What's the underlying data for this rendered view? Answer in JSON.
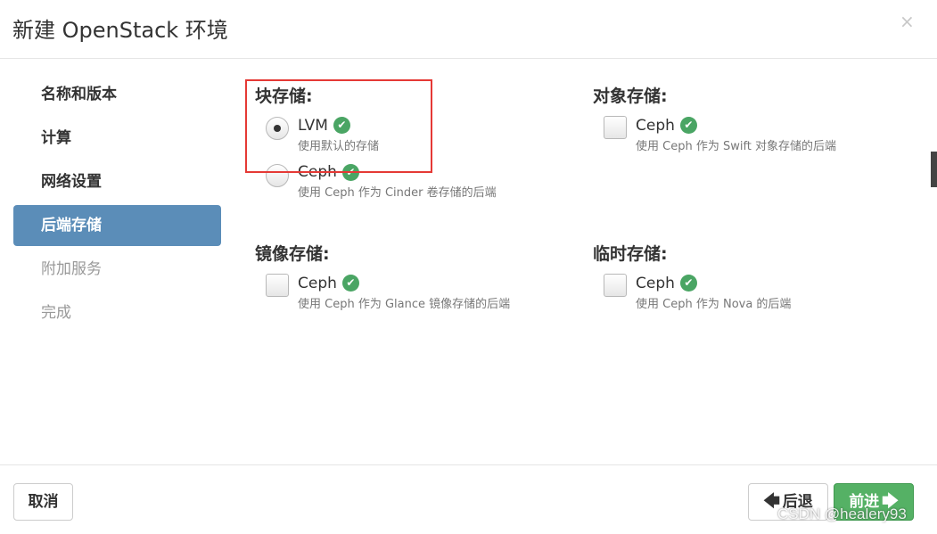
{
  "dialog": {
    "title": "新建 OpenStack 环境",
    "close_symbol": "×"
  },
  "sidebar": {
    "items": [
      {
        "label": "名称和版本"
      },
      {
        "label": "计算"
      },
      {
        "label": "网络设置"
      },
      {
        "label": "后端存储"
      },
      {
        "label": "附加服务"
      },
      {
        "label": "完成"
      }
    ]
  },
  "storage": {
    "block": {
      "title": "块存储:",
      "options": [
        {
          "label": "LVM",
          "desc": "使用默认的存储",
          "selected": true
        },
        {
          "label": "Ceph",
          "desc": "使用 Ceph 作为 Cinder 卷存储的后端",
          "selected": false
        }
      ]
    },
    "object": {
      "title": "对象存储:",
      "options": [
        {
          "label": "Ceph",
          "desc": "使用 Ceph 作为 Swift 对象存储的后端",
          "checked": false
        }
      ]
    },
    "image": {
      "title": "镜像存储:",
      "options": [
        {
          "label": "Ceph",
          "desc": "使用 Ceph 作为 Glance 镜像存储的后端",
          "checked": false
        }
      ]
    },
    "ephemeral": {
      "title": "临时存储:",
      "options": [
        {
          "label": "Ceph",
          "desc": "使用 Ceph 作为 Nova 的后端",
          "checked": false
        }
      ]
    }
  },
  "footer": {
    "cancel_label": "取消",
    "back_label": "后退",
    "next_label": "前进"
  },
  "watermark": "CSDN @healery93",
  "colors": {
    "active_nav": "#5b8db8",
    "success": "#4aa564",
    "next_button": "#55b165",
    "highlight": "#e53935"
  },
  "icons": {
    "close": "close-icon",
    "check": "check-circle-icon",
    "back": "arrow-left-icon",
    "next": "arrow-right-icon"
  }
}
